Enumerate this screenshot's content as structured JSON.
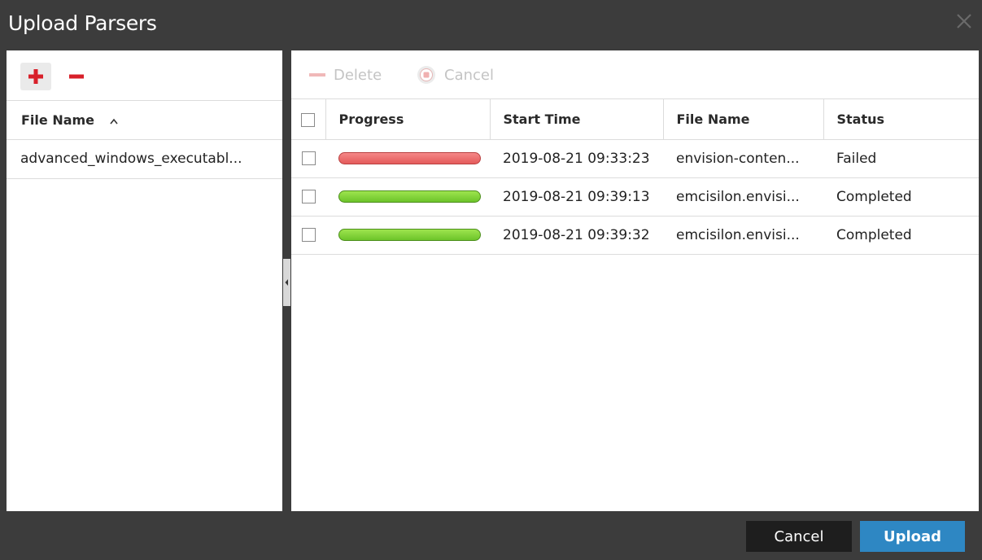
{
  "dialog": {
    "title": "Upload Parsers",
    "close_icon": "close-icon"
  },
  "left_panel": {
    "add_icon": "plus-icon",
    "remove_icon": "minus-icon",
    "column_header": "File Name",
    "sort_icon": "chevron-up-icon",
    "files": [
      "advanced_windows_executabl..."
    ]
  },
  "right_panel": {
    "toolbar": {
      "delete_label": "Delete",
      "cancel_label": "Cancel"
    },
    "columns": [
      "Progress",
      "Start Time",
      "File Name",
      "Status"
    ],
    "rows": [
      {
        "progress_state": "failed",
        "progress": 1.0,
        "start_time": "2019-08-21 09:33:23",
        "file_name": "envision-conten...",
        "status": "Failed"
      },
      {
        "progress_state": "completed",
        "progress": 1.0,
        "start_time": "2019-08-21 09:39:13",
        "file_name": "emcisilon.envisi...",
        "status": "Completed"
      },
      {
        "progress_state": "completed",
        "progress": 1.0,
        "start_time": "2019-08-21 09:39:32",
        "file_name": "emcisilon.envisi...",
        "status": "Completed"
      }
    ]
  },
  "footer": {
    "cancel_label": "Cancel",
    "upload_label": "Upload"
  },
  "colors": {
    "title_bar": "#3c3c3c",
    "accent_add": "#d8202a",
    "failed": "#e45a5a",
    "completed": "#6cc42a",
    "primary_button": "#2e87c3"
  }
}
